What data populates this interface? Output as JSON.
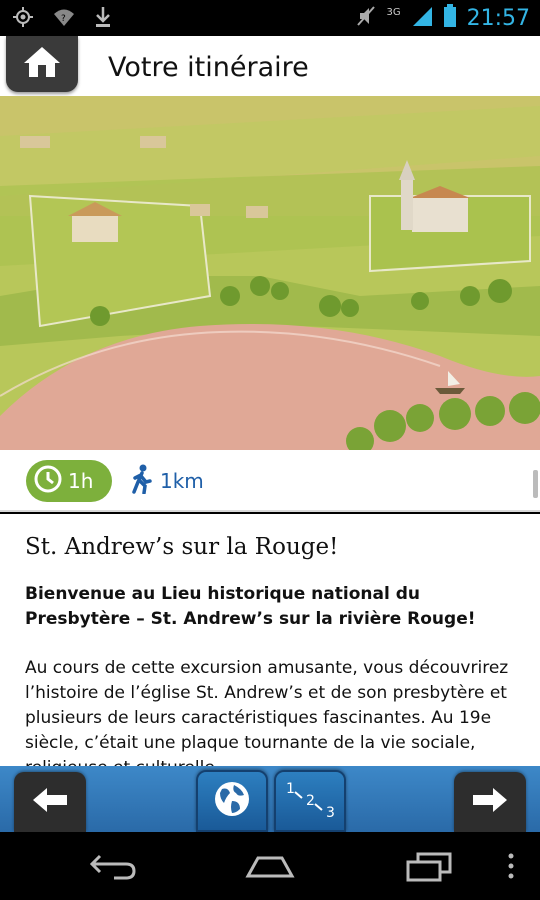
{
  "status_bar": {
    "time": "21:57",
    "network": "3G",
    "icons": [
      "gps-icon",
      "wifi-icon",
      "download-icon",
      "mute-icon",
      "signal-icon",
      "battery-icon"
    ]
  },
  "header": {
    "title": "Votre itinéraire",
    "home_icon": "home-icon"
  },
  "info": {
    "duration": "1h",
    "distance": "1km",
    "accent_green": "#7db03c",
    "accent_blue": "#1f5fa8"
  },
  "content": {
    "title": "St. Andrew’s sur la Rouge!",
    "lead": "Bienvenue au Lieu historique national du Presbytère – St. Andrew’s sur la rivière Rouge!",
    "body": "Au cours de cette excursion amusante, vous découvrirez l’histoire de l’église St. Andrew’s et de son presbytère et plusieurs de leurs caractéristiques fascinantes. Au 19e siècle, c’était une plaque tournante de la vie sociale, religieuse et culturelle"
  },
  "bottom_nav": {
    "steps_label_1": "1",
    "steps_label_2": "2",
    "steps_label_3": "3"
  }
}
